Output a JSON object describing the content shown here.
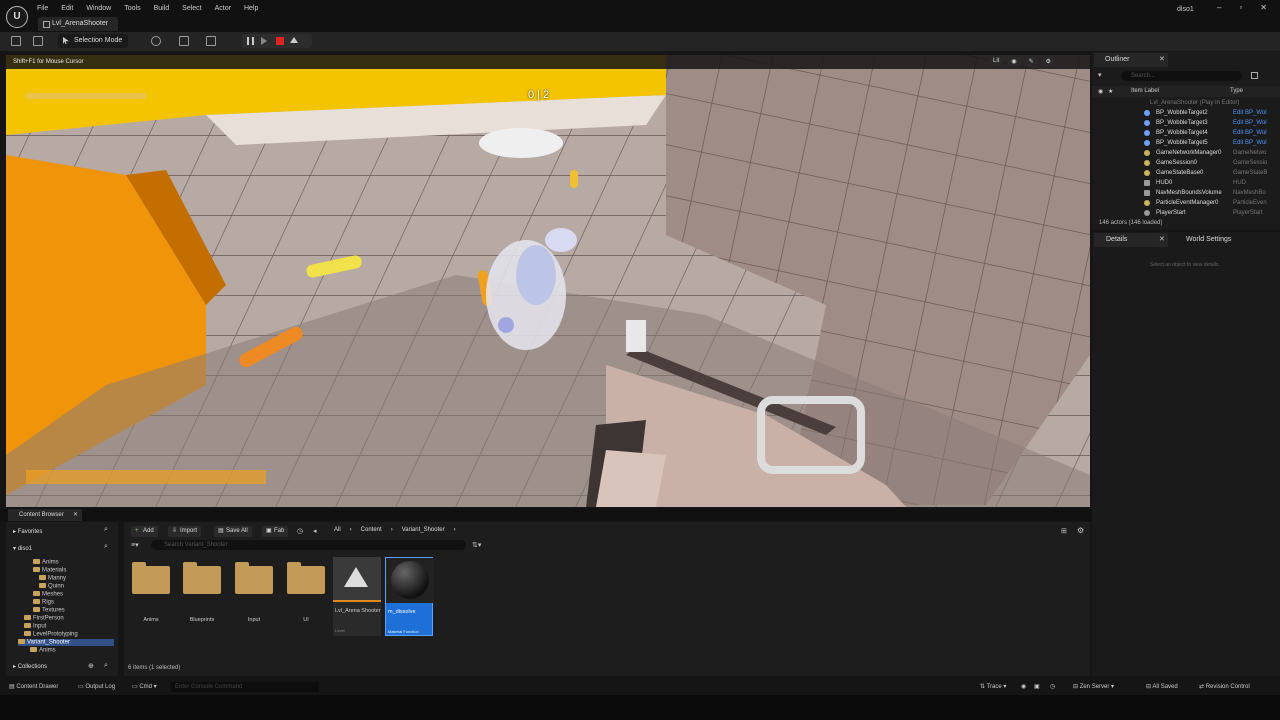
{
  "app": {
    "logo": "U",
    "project": "diso1",
    "tab": "Lvl_ArenaShooter"
  },
  "menu": [
    "File",
    "Edit",
    "Window",
    "Tools",
    "Build",
    "Select",
    "Actor",
    "Help"
  ],
  "toolbar": {
    "mode": "Selection Mode"
  },
  "viewport": {
    "hint": "Shift+F1 for Mouse Cursor",
    "lit": "Lit",
    "score_left": "0",
    "score_right": "2"
  },
  "outliner": {
    "title": "Outliner",
    "search_placeholder": "Search...",
    "col_label": "Item Label",
    "col_type": "Type",
    "root": "Lvl_ArenaShooter (Play In Editor)",
    "rows": [
      {
        "label": "BP_WobbleTarget2",
        "type": "Edit BP_Wol"
      },
      {
        "label": "BP_WobbleTarget3",
        "type": "Edit BP_Wol"
      },
      {
        "label": "BP_WobbleTarget4",
        "type": "Edit BP_Wol"
      },
      {
        "label": "BP_WobbleTarget5",
        "type": "Edit BP_Wol"
      },
      {
        "label": "GameNetworkManager0",
        "type": "GameNetwo"
      },
      {
        "label": "GameSession0",
        "type": "GameSessio"
      },
      {
        "label": "GameStateBase0",
        "type": "GameStateB"
      },
      {
        "label": "HUD0",
        "type": "HUD"
      },
      {
        "label": "NavMeshBoundsVolume",
        "type": "NavMeshBo"
      },
      {
        "label": "ParticleEventManager0",
        "type": "ParticleEven"
      },
      {
        "label": "PlayerStart",
        "type": "PlayerStart"
      }
    ],
    "count": "146 actors (146 loaded)"
  },
  "details": {
    "title": "Details",
    "world_settings": "World Settings",
    "hint": "Select an object to view details."
  },
  "content_browser": {
    "tab": "Content Browser",
    "favorites": "Favorites",
    "root": "diso1",
    "tree": [
      "Anims",
      "Materials",
      "Manny",
      "Quinn",
      "Meshes",
      "Rigs",
      "Textures",
      "FirstPerson",
      "Input",
      "LevelPrototyping",
      "Variant_Shooter",
      "Anims"
    ],
    "collections": "Collections",
    "add": "Add",
    "import": "Import",
    "save_all": "Save All",
    "fab": "Fab",
    "crumbs": [
      "All",
      "Content",
      "Variant_Shooter"
    ],
    "search_placeholder": "Search Variant_Shooter",
    "assets": [
      {
        "name": "Anims"
      },
      {
        "name": "Blueprints"
      },
      {
        "name": "Input"
      },
      {
        "name": "UI"
      },
      {
        "name": "Lvl_Arena Shooter",
        "sub": "Level"
      },
      {
        "name": "m_dissolve",
        "sub": "Material Function"
      }
    ],
    "count": "6 items (1 selected)"
  },
  "statusbar": {
    "drawer": "Content Drawer",
    "output": "Output Log",
    "cmd": "Cmd",
    "console_placeholder": "Enter Console Command",
    "trace": "Trace",
    "zen": "Zen Server",
    "saved": "All Saved",
    "revision": "Revision Control"
  }
}
